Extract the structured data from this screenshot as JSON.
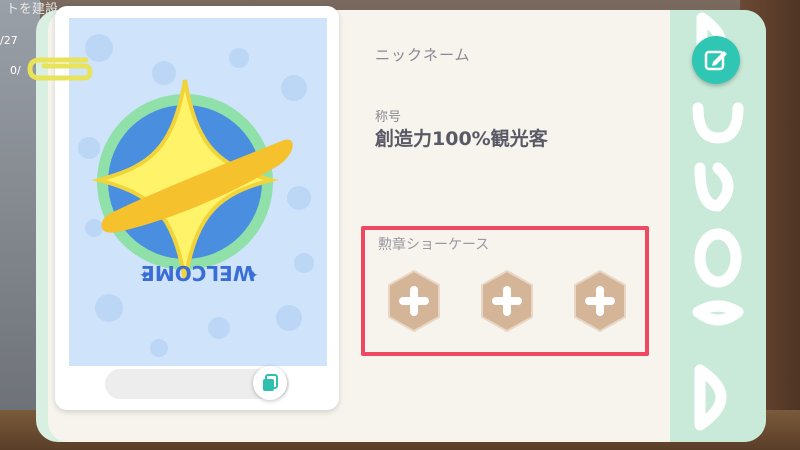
{
  "background": {
    "top_text": "トを建設",
    "count_a": "/27",
    "count_b": "0/"
  },
  "profile": {
    "nickname_label": "ニックネーム",
    "title_label": "称号",
    "title_value": "創造力100%観光客",
    "card_banner_text": "WELCOME"
  },
  "showcase": {
    "label": "勲章ショーケース",
    "slots": [
      {
        "icon": "plus-icon",
        "state": "empty"
      },
      {
        "icon": "plus-icon",
        "state": "empty"
      },
      {
        "icon": "plus-icon",
        "state": "empty"
      }
    ]
  },
  "side_strip": {
    "text": "Dream"
  },
  "colors": {
    "accent_teal": "#2fc7b3",
    "highlight_red": "#ef4862",
    "badge_tan": "#d4b597",
    "panel_cream": "#f7f3ed",
    "side_mint": "#c9ead9",
    "card_sky": "#cfe3fb"
  },
  "icons": [
    "copy-icon",
    "edit-icon",
    "paperclip-icon",
    "star-planet-icon",
    "plus-icon"
  ]
}
